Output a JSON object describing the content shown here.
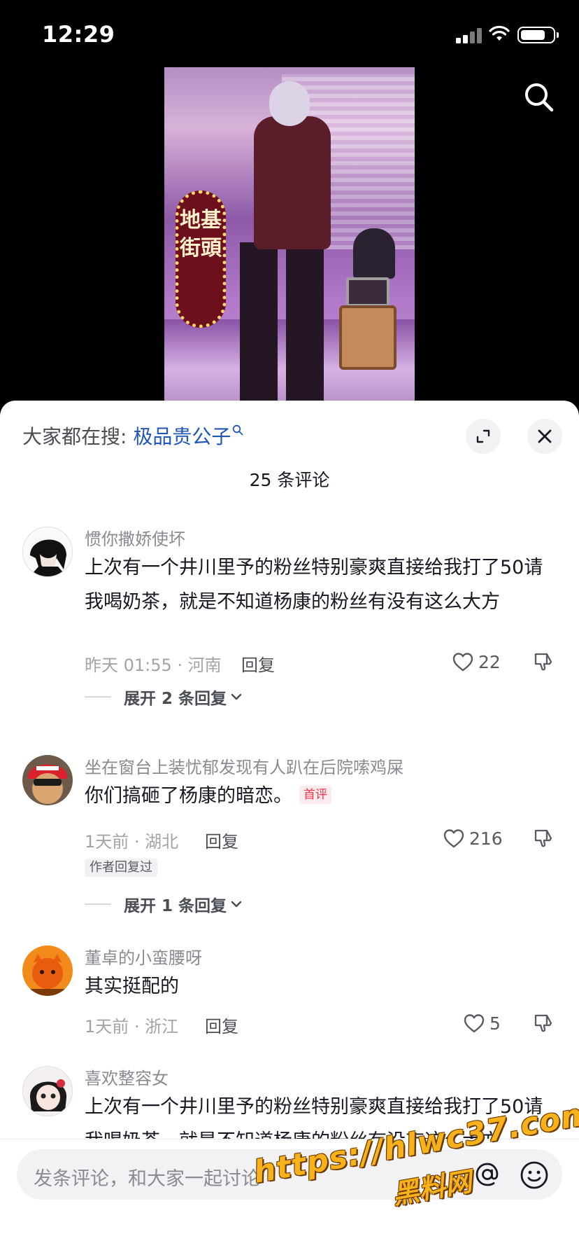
{
  "status_bar": {
    "time": "12:29"
  },
  "video": {
    "sign_text": "地基街頭"
  },
  "hot_search": {
    "prefix": "大家都在搜: ",
    "keyword": "极品贵公子"
  },
  "header": {
    "comment_count": "25 条评论"
  },
  "comments": [
    {
      "username": "惯你撒娇使坏",
      "text": "上次有一个井川里予的粉丝特别豪爽直接给我打了50请我喝奶茶，就是不知道杨康的粉丝有没有这么大方",
      "meta": "昨天 01:55 · 河南",
      "reply_label": "回复",
      "likes": "22",
      "expand_label": "展开 2 条回复"
    },
    {
      "username": "坐在窗台上装忧郁发现有人趴在后院嗦鸡屎",
      "text": "你们搞砸了杨康的暗恋。",
      "badge": "首评",
      "meta": "1天前 · 湖北",
      "reply_label": "回复",
      "likes": "216",
      "author_tag": "作者回复过",
      "expand_label": "展开 1 条回复"
    },
    {
      "username": "董卓的小蛮腰呀",
      "text": "其实挺配的",
      "meta": "1天前 · 浙江",
      "reply_label": "回复",
      "likes": "5"
    },
    {
      "username": "喜欢整容女",
      "text": "上次有一个井川里予的粉丝特别豪爽直接给我打了50请我喝奶茶，就是不知道杨康的粉丝有没有这么大方"
    }
  ],
  "input": {
    "placeholder": "发条评论，和大家一起讨论"
  },
  "watermark": {
    "url": "https://hlwc37.com",
    "name": "黑料网"
  },
  "colors": {
    "accent_link": "#1f57b8",
    "badge_red": "#f2354a",
    "watermark": "#f7b21b"
  },
  "icons": [
    "search-icon",
    "expand-icon",
    "close-icon",
    "heart-icon",
    "dislike-icon",
    "chevron-down-icon",
    "at-icon",
    "emoji-icon",
    "wifi-icon",
    "battery-icon",
    "signal-icon"
  ]
}
